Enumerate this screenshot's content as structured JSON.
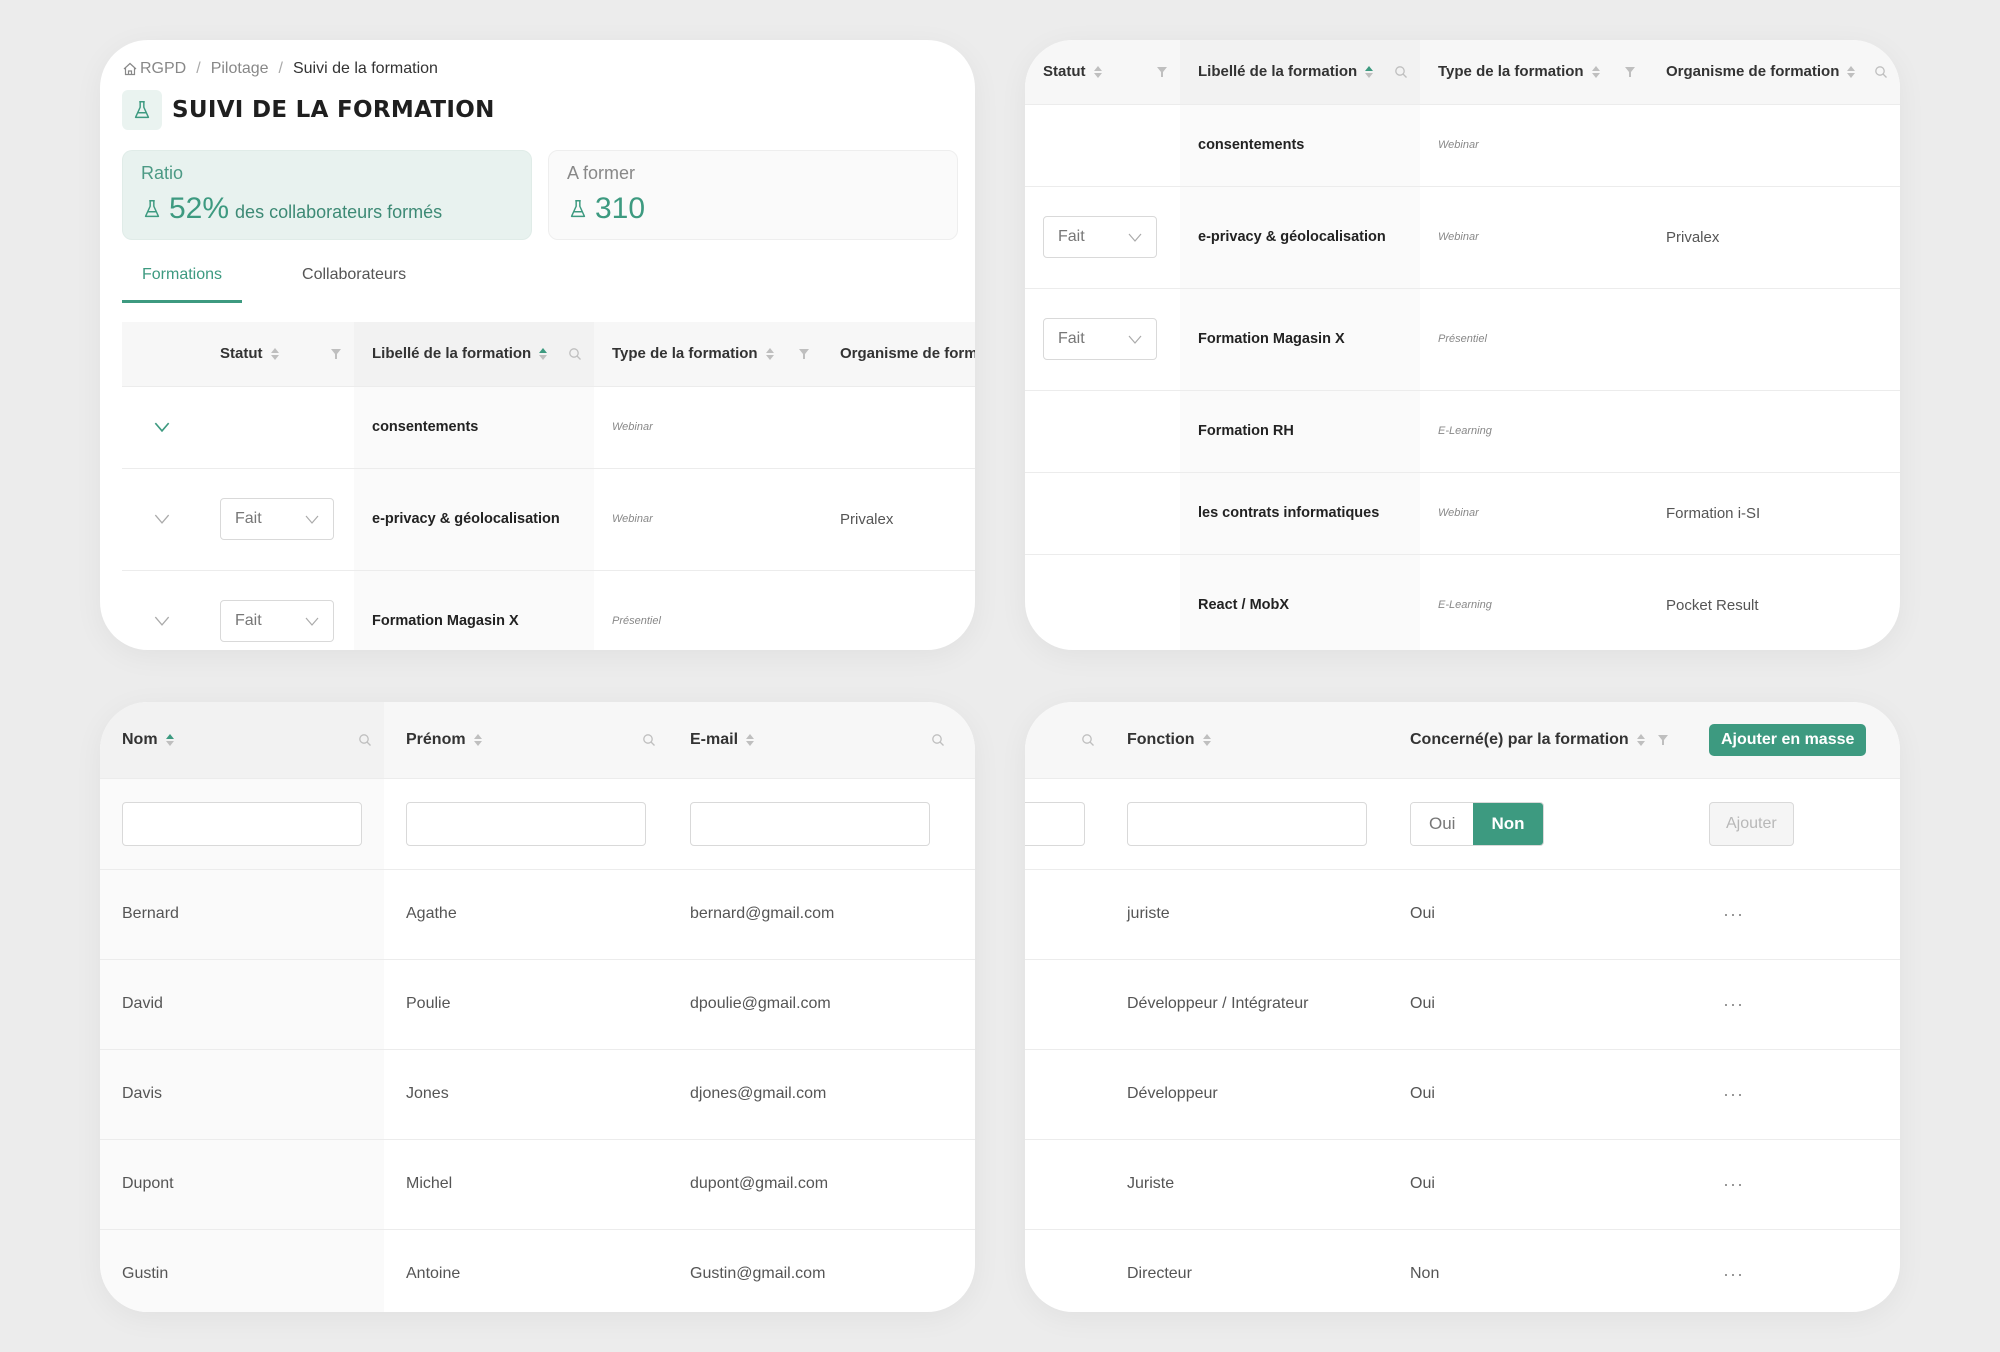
{
  "colors": {
    "accent": "#3d9a80",
    "accent_light": "#e8f2ef",
    "background": "#ececec"
  },
  "breadcrumb": {
    "items": [
      "RGPD",
      "Pilotage",
      "Suivi de la formation"
    ],
    "separator": "/"
  },
  "page": {
    "title": "SUIVI DE LA FORMATION",
    "icon": "flask-icon"
  },
  "stats": {
    "ratio": {
      "label": "Ratio",
      "value": "52%",
      "suffix": "des collaborateurs formés"
    },
    "a_former": {
      "label": "A former",
      "value": "310"
    }
  },
  "tabs": [
    {
      "label": "Formations",
      "active": true
    },
    {
      "label": "Collaborateurs",
      "active": false
    }
  ],
  "formations_table": {
    "columns": {
      "statut": "Statut",
      "libelle": "Libellé de la formation",
      "type": "Type de la formation",
      "organisme": "Organisme de formation",
      "organisme_truncated": "Organisme de form"
    },
    "rows": [
      {
        "statut": "",
        "libelle": "consentements",
        "type": "Webinar",
        "organisme": ""
      },
      {
        "statut": "Fait",
        "libelle": "e-privacy & géolocalisation",
        "type": "Webinar",
        "organisme": "Privalex"
      },
      {
        "statut": "Fait",
        "libelle": "Formation Magasin X",
        "type": "Présentiel",
        "organisme": ""
      },
      {
        "statut": "",
        "libelle": "Formation RH",
        "type": "E-Learning",
        "organisme": ""
      },
      {
        "statut": "",
        "libelle": "les contrats informatiques",
        "type": "Webinar",
        "organisme": "Formation i-SI"
      },
      {
        "statut": "",
        "libelle": "React / MobX",
        "type": "E-Learning",
        "organisme": "Pocket Result"
      }
    ]
  },
  "collaborateurs_table": {
    "columns": {
      "nom": "Nom",
      "prenom": "Prénom",
      "email": "E-mail",
      "fonction": "Fonction",
      "concerne": "Concerné(e) par la formation"
    },
    "bulk_add_label": "Ajouter en masse",
    "new_row": {
      "nom": "",
      "prenom": "",
      "email": "",
      "fonction": "",
      "toggle_oui": "Oui",
      "toggle_non": "Non",
      "toggle_selected": "Non",
      "add_label": "Ajouter"
    },
    "rows": [
      {
        "nom": "Bernard",
        "prenom": "Agathe",
        "email": "bernard@gmail.com",
        "fonction": "juriste",
        "concerne": "Oui"
      },
      {
        "nom": "David",
        "prenom": "Poulie",
        "email": "dpoulie@gmail.com",
        "fonction": "Développeur / Intégrateur",
        "concerne": "Oui"
      },
      {
        "nom": "Davis",
        "prenom": "Jones",
        "email": "djones@gmail.com",
        "fonction": "Développeur",
        "concerne": "Oui"
      },
      {
        "nom": "Dupont",
        "prenom": "Michel",
        "email": "dupont@gmail.com",
        "fonction": "Juriste",
        "concerne": "Oui"
      },
      {
        "nom": "Gustin",
        "prenom": "Antoine",
        "email": "Gustin@gmail.com",
        "fonction": "Directeur",
        "concerne": "Non"
      }
    ],
    "row_action": "···"
  }
}
